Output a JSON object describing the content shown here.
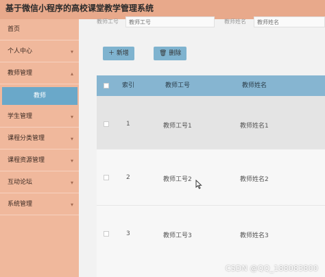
{
  "header": {
    "title": "基于微信小程序的高校课堂教学管理系统"
  },
  "sidebar": {
    "items": [
      {
        "label": "首页",
        "has_chevron": false
      },
      {
        "label": "个人中心",
        "has_chevron": true
      },
      {
        "label": "教师管理",
        "has_chevron": true
      },
      {
        "label": "学生管理",
        "has_chevron": true
      },
      {
        "label": "课程分类管理",
        "has_chevron": true
      },
      {
        "label": "课程资源管理",
        "has_chevron": true
      },
      {
        "label": "互动论坛",
        "has_chevron": true
      },
      {
        "label": "系统管理",
        "has_chevron": true
      }
    ],
    "active_sub_item": "教师"
  },
  "search": {
    "teacher_id_label": "教师工号",
    "teacher_id_placeholder": "教师工号",
    "teacher_name_label": "教师姓名",
    "teacher_name_placeholder": "教师姓名"
  },
  "toolbar": {
    "add_label": "新增",
    "delete_label": "删除"
  },
  "table": {
    "headers": [
      "索引",
      "教师工号",
      "教师姓名"
    ],
    "rows": [
      {
        "index": "1",
        "teacher_id": "教师工号1",
        "teacher_name": "教师姓名1"
      },
      {
        "index": "2",
        "teacher_id": "教师工号2",
        "teacher_name": "教师姓名2"
      },
      {
        "index": "3",
        "teacher_id": "教师工号3",
        "teacher_name": "教师姓名3"
      }
    ]
  },
  "watermark": "CSDN @QQ_188083800",
  "colors": {
    "header_bg": "#e8a98b",
    "sidebar_bg": "#f0b89c",
    "accent_blue": "#6aa8c9",
    "table_header_bg": "#86b5d1"
  }
}
